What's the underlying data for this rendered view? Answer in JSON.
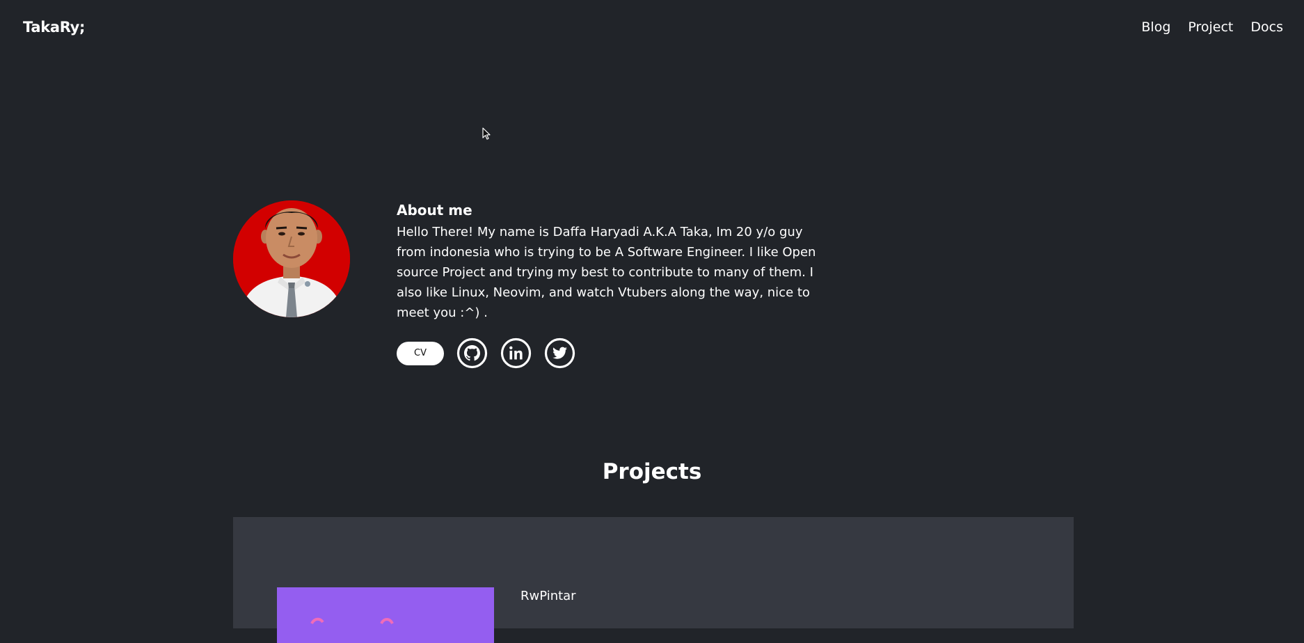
{
  "header": {
    "brand": "TakaRy;",
    "nav": [
      {
        "label": "Blog"
      },
      {
        "label": "Project"
      },
      {
        "label": "Docs"
      }
    ]
  },
  "about": {
    "title": "About me",
    "body": "Hello There! My name is Daffa Haryadi A.K.A Taka, Im 20 y/o guy from indonesia who is trying to be A Software Engineer. I like Open source Project and trying my best to contribute to many of them. I also like Linux, Neovim, and watch Vtubers along the way, nice to meet you :^) .",
    "cv_label": "CV",
    "socials": [
      {
        "icon": "github-icon"
      },
      {
        "icon": "linkedin-icon"
      },
      {
        "icon": "twitter-icon"
      }
    ]
  },
  "projects": {
    "title": "Projects",
    "items": [
      {
        "name": "RwPintar"
      }
    ]
  },
  "colors": {
    "background": "#212429",
    "panel": "#363941",
    "avatar_background": "#d20000",
    "project_thumb": "#945ef0",
    "text": "#ffffff"
  }
}
